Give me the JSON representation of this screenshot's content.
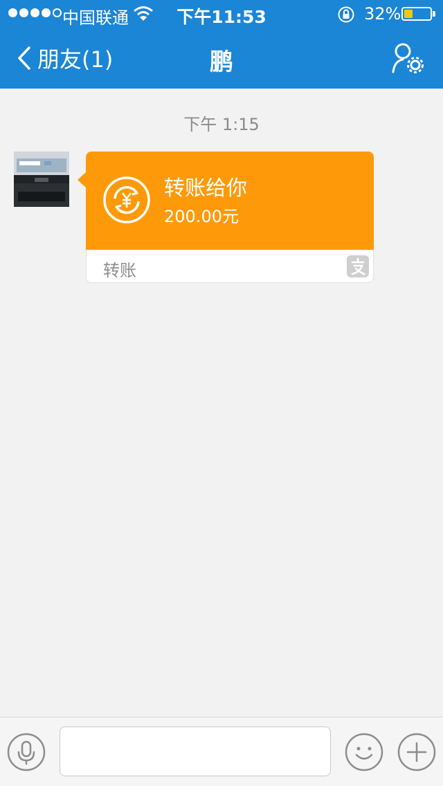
{
  "status_bar": {
    "carrier": "中国联通",
    "time": "下午11:53",
    "battery_percent": "32%",
    "battery_level": 0.32,
    "signal_bars_filled": 4,
    "signal_bars_total": 5
  },
  "nav": {
    "back_label": "朋友(1)",
    "title": "鹏"
  },
  "chat": {
    "timestamp": "下午 1:15",
    "message": {
      "title": "转账给你",
      "amount": "200.00元",
      "footer_label": "转账"
    }
  },
  "input_bar": {
    "text_value": "",
    "placeholder": ""
  },
  "colors": {
    "nav_bar": "#1b85d6",
    "transfer_bubble": "#fe9a0a",
    "background": "#f2f2f2",
    "battery": "#f5c518"
  },
  "icons": {
    "back": "chevron-left-icon",
    "profile_settings": "user-settings-icon",
    "transfer": "yuan-transfer-icon",
    "alipay": "alipay-icon",
    "mic": "microphone-icon",
    "emoji": "smiley-icon",
    "add": "plus-icon",
    "wifi": "wifi-icon",
    "lock": "rotation-lock-icon"
  }
}
